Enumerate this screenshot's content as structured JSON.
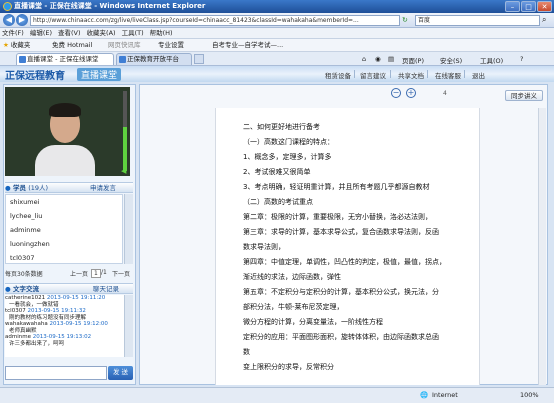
{
  "window": {
    "title": "直播课堂 - 正保在线课堂 - Windows Internet Explorer"
  },
  "address": {
    "url": "http://www.chinaacc.com/zg/live/liveClass.jsp?courseId=chinaacc_81423&classId=wahakaha&memberId=...",
    "search_engine": "百度"
  },
  "menu": [
    "文件(F)",
    "编辑(E)",
    "查看(V)",
    "收藏夹(A)",
    "工具(T)",
    "帮助(H)"
  ],
  "favorites": {
    "label": "收藏夹",
    "items": [
      "免费 Hotmail",
      "网页快讯库",
      "专业设置",
      "自考专业—自学考试—..."
    ]
  },
  "tabs": [
    "直播课堂 - 正保在线课堂",
    "正保教育开放平台"
  ],
  "commands": {
    "page": "页面(P)",
    "safety": "安全(S)",
    "tools": "工具(O)"
  },
  "app": {
    "logo": "正保远程教育",
    "logo2": "直播课堂",
    "nav": [
      "租赁设备",
      "留言建议",
      "共享文档",
      "在线客服",
      "退出"
    ]
  },
  "students": {
    "title": "学员",
    "count": "(19人)",
    "apply": "申请发言",
    "list": [
      "shixumei",
      "lychee_liu",
      "adminme",
      "luoningzhen",
      "tcl0307"
    ]
  },
  "pager": {
    "label": "每页30条数据",
    "prev": "上一页",
    "current": "1",
    "total": "/1",
    "next": "下一页"
  },
  "chat": {
    "title": "文字交流",
    "record": "聊天记录",
    "messages": [
      {
        "name": "catherine1021",
        "time": "2013-09-15 19:11:20",
        "text": "一看就会，一做就错"
      },
      {
        "name": "tcl0307",
        "time": "2013-09-15 19:11:32",
        "text": "刚的教材的练习题没有同步理解"
      },
      {
        "name": "wahakawahaha",
        "time": "2013-09-15 19:12:00",
        "text": "老师真幽默"
      },
      {
        "name": "adminme",
        "time": "2013-09-15 19:13:02",
        "text": "许三多都出来了，呵呵"
      }
    ],
    "send": "发 送"
  },
  "viewer": {
    "page": "4",
    "sync": "同步讲义",
    "zoom_in": "+",
    "zoom_out": "−"
  },
  "doc": {
    "lines": [
      "二、如何更好地进行备考",
      "（一）高数这门课程的特点：",
      "1、概念多，定理多，计算多",
      "2、考试很难又很简单",
      "3、考点明确，轻证明重计算，并且所有考题几乎都源自教材",
      "（二）高数的考试重点",
      "第二章：极限的计算，重要极限，无穷小替换，洛必达法则，",
      "第三章：求导的计算，基本求导公式，复合函数求导法则，反函",
      "数求导法则，",
      "第四章：中值定理，单调性，凹凸性的判定，极值，最值，拐点，",
      "渐近线的求法，边际函数，弹性",
      "第五章：不定积分与定积分的计算，基本积分公式，换元法，分",
      "部积分法，牛顿-莱布尼茨定理，",
      "微分方程的计算，分离变量法，一阶线性方程",
      "定积分的应用：平面图形面积，旋转体体积，由边际函数求总函",
      "数",
      "变上限积分的求导，反常积分"
    ]
  },
  "status": {
    "zone": "Internet",
    "zoom": "100%"
  }
}
